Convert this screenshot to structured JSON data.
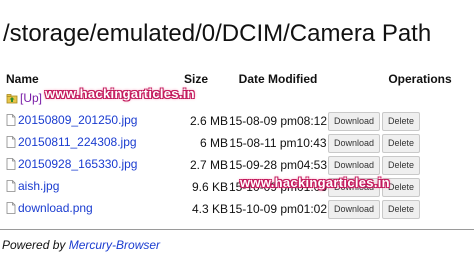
{
  "header": {
    "path": "/storage/emulated/0/DCIM/Camera Path"
  },
  "table": {
    "columns": {
      "name": "Name",
      "size": "Size",
      "date": "Date Modified",
      "ops": "Operations"
    },
    "up_label": "[Up]",
    "rows": [
      {
        "name": "20150809_201250.jpg",
        "size": "2.6 MB",
        "date": "15-08-09 pm08:12",
        "icon": "file-icon"
      },
      {
        "name": "20150811_224308.jpg",
        "size": "6 MB",
        "date": "15-08-11 pm10:43",
        "icon": "file-icon"
      },
      {
        "name": "20150928_165330.jpg",
        "size": "2.7 MB",
        "date": "15-09-28 pm04:53",
        "icon": "file-icon"
      },
      {
        "name": "aish.jpg",
        "size": "9.6 KB",
        "date": "15-10-09 pm01:03",
        "icon": "file-icon"
      },
      {
        "name": "download.png",
        "size": "4.3 KB",
        "date": "15-10-09 pm01:02",
        "icon": "file-icon"
      }
    ],
    "download_label": "Download",
    "delete_label": "Delete"
  },
  "footer": {
    "prefix": "Powered by ",
    "link": "Mercury-Browser"
  },
  "watermark": {
    "text": "www.hackingarticles.in"
  },
  "colors": {
    "link": "#1a3cd0",
    "up_link": "#7a1ea8",
    "watermark_glow": "#c2185b"
  }
}
